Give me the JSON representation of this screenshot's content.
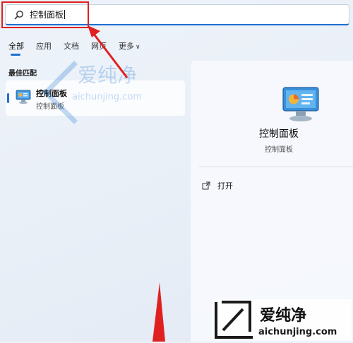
{
  "search": {
    "value": "控制面板"
  },
  "tabs": [
    {
      "label": "全部"
    },
    {
      "label": "应用"
    },
    {
      "label": "文档"
    },
    {
      "label": "网页"
    },
    {
      "label": "更多"
    }
  ],
  "section": {
    "label": "最佳匹配"
  },
  "best_match": {
    "title": "控制面板",
    "subtitle": "控制面板"
  },
  "detail": {
    "title": "控制面板",
    "subtitle": "控制面板",
    "action_open": "打开"
  },
  "watermark": {
    "brand": "爱纯净",
    "url": "aichunjing.com"
  },
  "colors": {
    "accent": "#1f6fd0",
    "annotation": "#e02020"
  }
}
